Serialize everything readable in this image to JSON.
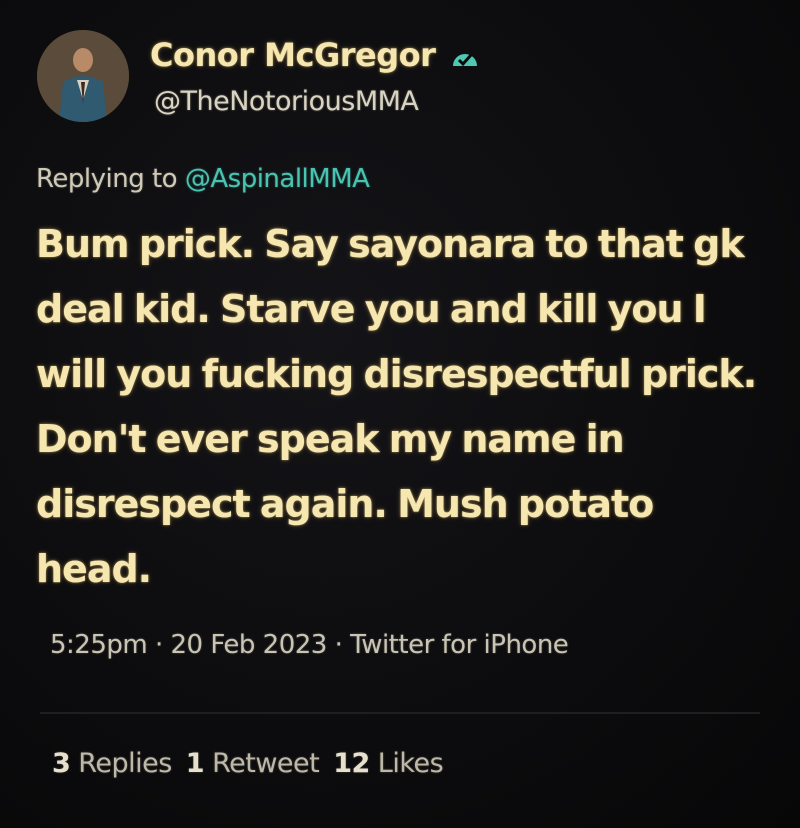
{
  "tweet": {
    "author": {
      "name": "Conor McGregor",
      "handle": "@TheNotoriousMMA",
      "verified_icon": "verified-badge-icon"
    },
    "reply": {
      "prefix": "Replying to",
      "mention": "@AspinallMMA"
    },
    "text": "Bum prick. Say sayonara to that gk deal kid. Starve you and kill you I will you fucking disrespectful prick. Don't ever speak my name in disrespect again. Mush potato head.",
    "meta": "5:25pm · 20 Feb 2023 · Twitter for iPhone",
    "stats": {
      "replies_count": "3",
      "replies_label": "Replies",
      "retweets_count": "1",
      "retweets_label": "Retweet",
      "likes_count": "12",
      "likes_label": "Likes"
    }
  },
  "colors": {
    "text_glow": "#f6e7b0",
    "mention": "#48c4b0",
    "verified": "#4fc7b2",
    "background": "#0b0b0c"
  }
}
